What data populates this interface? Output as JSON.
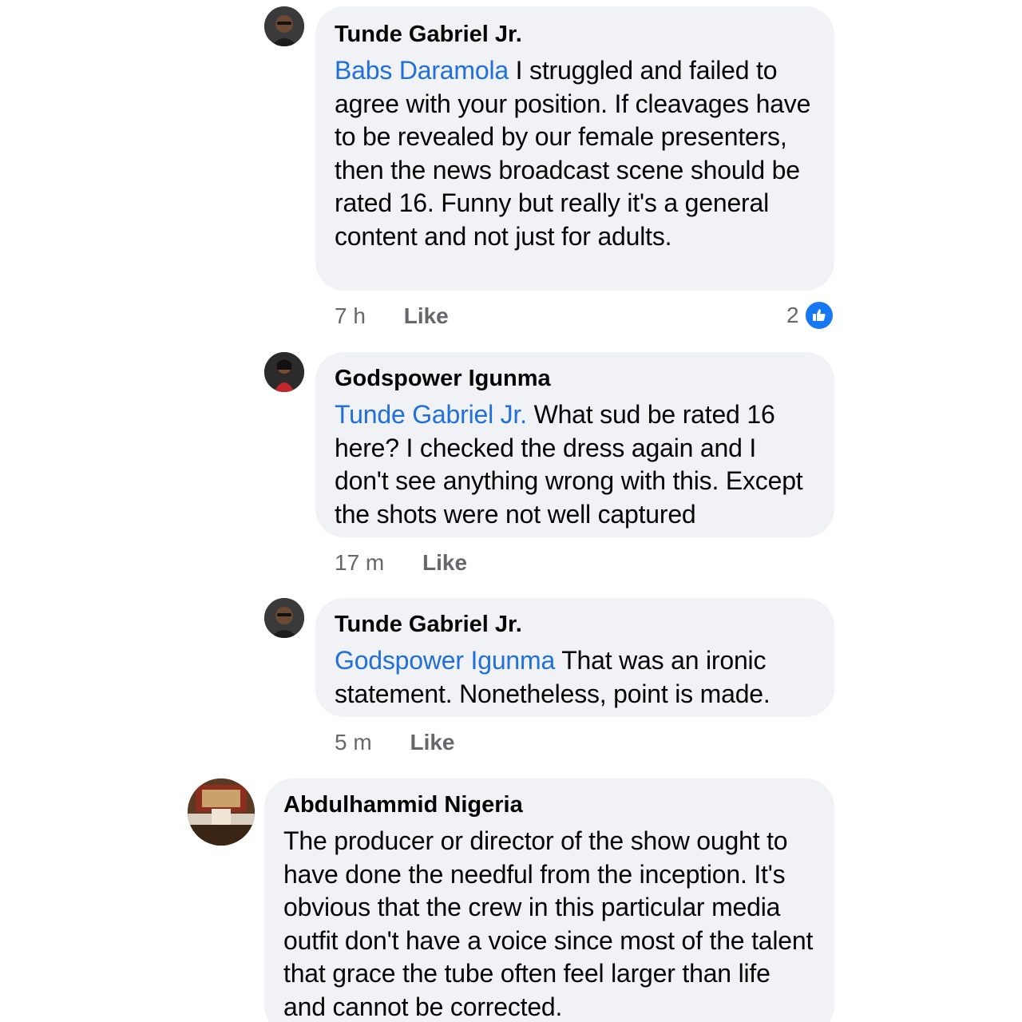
{
  "comments": [
    {
      "author": "Tunde Gabriel Jr.",
      "mention": "Babs Daramola",
      "text": " I struggled and failed to agree with your position. If cleavages have to be revealed by our female presenters, then the news broadcast scene should be rated 16. Funny but really it's a general content and not just for adults.",
      "time": "7 h",
      "like_label": "Like",
      "reaction_count": "2",
      "reaction_icon": "thumbs-up-icon",
      "avatar": "profile-photo-man-in-glasses"
    },
    {
      "author": "Godspower Igunma",
      "mention": "Tunde Gabriel Jr.",
      "text": " What sud be rated 16 here? I checked the dress again and I don't see anything wrong with this. Except the shots were not well captured",
      "time": "17 m",
      "like_label": "Like",
      "avatar": "profile-photo-woman-red-dress"
    },
    {
      "author": "Tunde Gabriel Jr.",
      "mention": "Godspower Igunma",
      "text": " That was an ironic statement. Nonetheless, point is made.",
      "time": "5 m",
      "like_label": "Like",
      "avatar": "profile-photo-man-in-glasses"
    },
    {
      "author": "Abdulhammid Nigeria",
      "text": "The producer or director of the show ought to have done the needful from the inception. It's obvious that the crew in this particular media outfit don't have a voice since most of the talent that grace the tube often feel larger than life and cannot be corrected.",
      "avatar": "profile-photo-interior-hall"
    }
  ],
  "colors": {
    "bubble": "#f0f2f5",
    "mention": "#216fdb",
    "meta": "#65676b",
    "like_badge": "#1877f2"
  }
}
